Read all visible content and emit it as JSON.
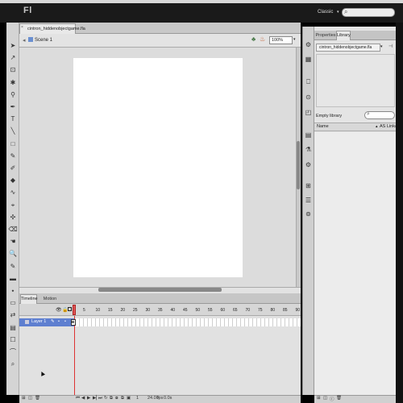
{
  "app": {
    "logo": "Fl",
    "workspace": "Classic",
    "workspace_chevron": "▾"
  },
  "document": {
    "tab_name": "cintron_hiddenobjectgame.fla",
    "tab_close": "×",
    "scene": "Scene 1",
    "zoom": "100%",
    "zoom_chevron": "▾"
  },
  "tools": [
    "➤",
    "↗",
    "⊡",
    "✱",
    "⚲",
    "✒",
    "T",
    "╲",
    "□",
    "✎",
    "✐",
    "◆",
    "∿",
    "⌖",
    "✣",
    "⌫",
    "☚",
    "🔍",
    "✎",
    "▬",
    "⬩",
    "▭",
    "⇄",
    "▤",
    "☐",
    "⌒",
    "⌕"
  ],
  "timeline": {
    "tabs": [
      "Timeline",
      "Motion Editor"
    ],
    "frame_numbers": [
      "5",
      "10",
      "15",
      "20",
      "25",
      "30",
      "35",
      "40",
      "45",
      "50",
      "55",
      "60",
      "65",
      "70",
      "75",
      "80",
      "85",
      "90"
    ],
    "layer_name": "Layer 1",
    "layer_pencil": "✎",
    "layer_dot": "•",
    "fps": "24.00",
    "fps_unit": "fps",
    "time": "0.0s",
    "frame_current": "1",
    "footer_icons": [
      "⊞",
      "◫",
      "🗑",
      "⏮",
      "◀",
      "▶",
      "▶▏",
      "⏭",
      "↻",
      "⧉",
      "⧇",
      "⧉",
      "▣"
    ]
  },
  "library": {
    "tabs": [
      "Properties",
      "Library"
    ],
    "file": "cintron_hiddenobjectgame.fla",
    "file_chevron": "▾",
    "status": "Empty library",
    "columns": [
      "Name",
      "AS Linkage"
    ],
    "sort_arrow": "▴",
    "footer_icons": [
      "⊞",
      "◫",
      "ⓘ",
      "🗑"
    ]
  },
  "panel_icons": [
    "⚙",
    "▦",
    "⎕",
    "⊙",
    "◰",
    "▤",
    "⚗",
    "⚙",
    "⊞",
    "☰",
    "⊚"
  ],
  "icons": {
    "search": "⌕",
    "pin": "⊣",
    "back": "◂",
    "eye": "👁",
    "lock": "🔒",
    "edit_symbol": "♣",
    "edit_scene": "♨",
    "cursor": "▲"
  },
  "colors": {
    "layer_selected": "#5e7fd0",
    "playhead": "#e25656",
    "stage": "#ffffff",
    "pasteboard": "#dcdcdc"
  }
}
